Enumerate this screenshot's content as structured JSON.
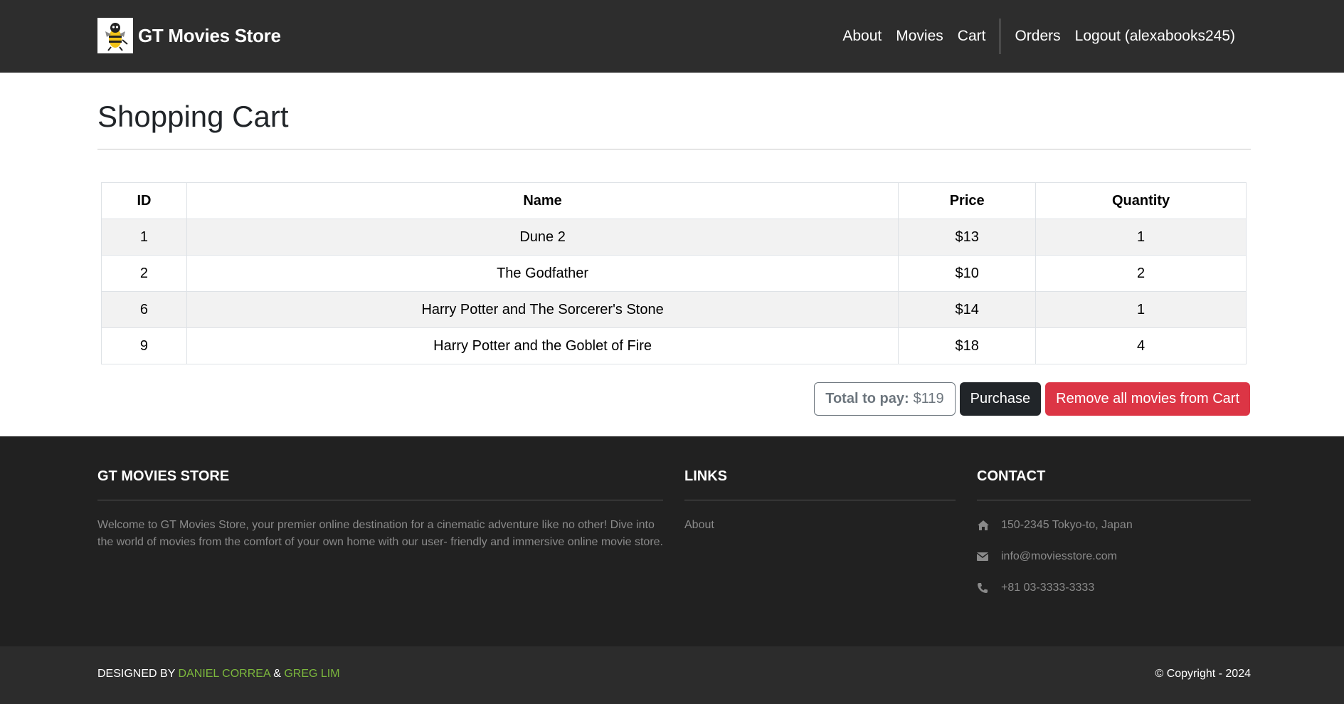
{
  "nav": {
    "brand": "GT Movies Store",
    "logo_icon": "hornet-mascot-icon",
    "links": [
      "About",
      "Movies",
      "Cart",
      "Orders",
      "Logout (alexabooks245)"
    ]
  },
  "page": {
    "title": "Shopping Cart"
  },
  "table": {
    "headers": [
      "ID",
      "Name",
      "Price",
      "Quantity"
    ],
    "rows": [
      [
        "1",
        "Dune 2",
        "$13",
        "1"
      ],
      [
        "2",
        "The Godfather",
        "$10",
        "2"
      ],
      [
        "6",
        "Harry Potter and The Sorcerer's Stone",
        "$14",
        "1"
      ],
      [
        "9",
        "Harry Potter and the Goblet of Fire",
        "$18",
        "4"
      ]
    ]
  },
  "actions": {
    "total_label": "Total to pay:",
    "total_value": "$119",
    "purchase_label": "Purchase",
    "remove_all_label": "Remove all movies from Cart",
    "purchase_color": "#212529",
    "remove_color": "#dc3545"
  },
  "footer": {
    "about_title": "GT MOVIES STORE",
    "about_text": "Welcome to GT Movies Store, your premier online destination for a cinematic adventure like no other! Dive into the world of movies from the comfort of your own home with our user- friendly and immersive online movie store.",
    "links_title": "LINKS",
    "links": [
      "About"
    ],
    "contact_title": "CONTACT",
    "address": "150-2345 Tokyo-to, Japan",
    "email": "info@moviesstore.com",
    "phone": "+81 03-3333-3333",
    "contact_icons": [
      "home-icon",
      "envelope-icon",
      "phone-icon"
    ]
  },
  "bottom": {
    "designed_prefix": "DESIGNED BY",
    "designer_1": "DANIEL CORREA",
    "ampersand": "&",
    "designer_2": "GREG LIM",
    "copyright": "© Copyright - 2024",
    "accent_color": "#7cb83d"
  }
}
